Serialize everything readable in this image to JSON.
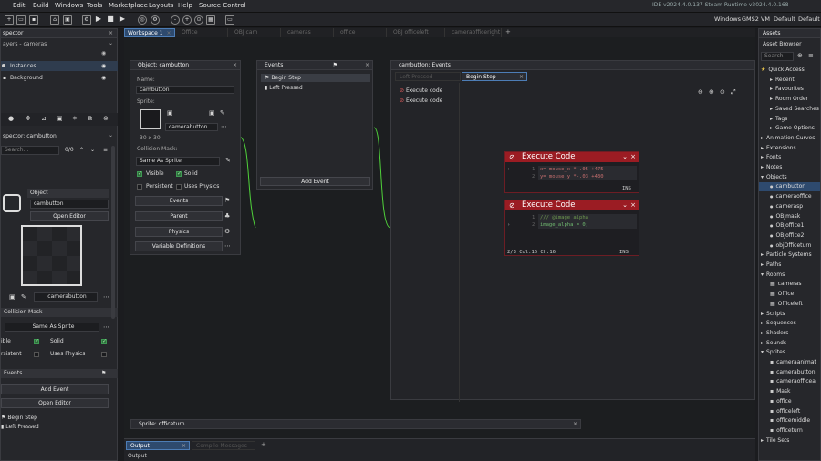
{
  "menu": {
    "items": [
      "Edit",
      "Build",
      "Windows",
      "Tools",
      "Marketplace",
      "Layouts",
      "Help",
      "Source Control"
    ]
  },
  "ide_info": "IDE v2024.4.0.137 Steam Runtime v2024.4.0.168",
  "target": {
    "platform": "Windows",
    "vm": "GMS2 VM",
    "config1": "Default",
    "config2": "Default"
  },
  "workspace_tab": "Workspace 1",
  "inactive_tabs": [
    "Office",
    "OBJ cam",
    "cameras",
    "office",
    "OBJ officeleft",
    "cameraofficeright"
  ],
  "left_inspector": {
    "title": "spector",
    "layers_label": "ayers - cameras",
    "layers": [
      "Instances",
      "Background"
    ],
    "sub_title": "spector: cambutton",
    "search_placeholder": "Search...",
    "count": "0/0",
    "object_section": "Object",
    "object_name": "cambutton",
    "open_editor": "Open Editor",
    "sprite_name": "camerabutton",
    "collision_section": "Collision Mask",
    "collision_value": "Same As Sprite",
    "visible": "ible",
    "solid": "Solid",
    "persistent": "rsistent",
    "uses_physics": "Uses Physics",
    "events_section": "Events",
    "add_event": "Add Event",
    "open_editor2": "Open Editor",
    "events": [
      "Begin Step",
      "Left Pressed"
    ]
  },
  "object_panel": {
    "title": "Object: cambutton",
    "name_label": "Name:",
    "name_value": "cambutton",
    "sprite_label": "Sprite:",
    "sprite_name": "camerabutton",
    "sprite_size": "30 x 30",
    "collision_label": "Collision Mask:",
    "collision_value": "Same As Sprite",
    "visible": "Visible",
    "solid": "Solid",
    "persistent": "Persistent",
    "uses_physics": "Uses Physics",
    "buttons": [
      "Events",
      "Parent",
      "Physics",
      "Variable Definitions"
    ]
  },
  "events_panel": {
    "title": "Events",
    "events": [
      "Begin Step",
      "Left Pressed"
    ],
    "add_event": "Add Event"
  },
  "code_window": {
    "title": "cambutton: Events",
    "tabs": [
      "Left Pressed",
      "Begin Step"
    ],
    "execute_list": [
      "Execute code",
      "Execute code"
    ],
    "blocks": [
      {
        "title": "Execute Code",
        "lines": [
          "x= mouse_x *-.05 +475",
          "y= mouse_y *-.03 +430"
        ],
        "status": "INS"
      },
      {
        "title": "Execute Code",
        "lines": [
          "/// @image alpha",
          "image_alpha = 0;"
        ],
        "status_left": "2/3 Col:16 Ch:16",
        "status": "INS"
      }
    ]
  },
  "sprite_panel_title": "Sprite: officeturn",
  "output": {
    "tab": "Output",
    "tab2": "Compile Messages",
    "label": "Output"
  },
  "assets": {
    "title": "Assets",
    "browser": "Asset Browser",
    "search_placeholder": "Search",
    "items": [
      {
        "label": "Quick Access",
        "indent": 0,
        "type": "star"
      },
      {
        "label": "Recent",
        "indent": 1,
        "type": "icon"
      },
      {
        "label": "Favourites",
        "indent": 1,
        "type": "icon"
      },
      {
        "label": "Room Order",
        "indent": 1,
        "type": "icon"
      },
      {
        "label": "Saved Searches",
        "indent": 1,
        "type": "icon"
      },
      {
        "label": "Tags",
        "indent": 1,
        "type": "icon"
      },
      {
        "label": "Game Options",
        "indent": 1,
        "type": "icon"
      },
      {
        "label": "Animation Curves",
        "indent": 0,
        "type": "folder"
      },
      {
        "label": "Extensions",
        "indent": 0,
        "type": "folder"
      },
      {
        "label": "Fonts",
        "indent": 0,
        "type": "folder"
      },
      {
        "label": "Notes",
        "indent": 0,
        "type": "folder"
      },
      {
        "label": "Objects",
        "indent": 0,
        "type": "folder-open"
      },
      {
        "label": "cambutton",
        "indent": 1,
        "type": "dot",
        "selected": true
      },
      {
        "label": "cameraoffice",
        "indent": 1,
        "type": "dot"
      },
      {
        "label": "camerasp",
        "indent": 1,
        "type": "dot"
      },
      {
        "label": "OBJmask",
        "indent": 1,
        "type": "dot"
      },
      {
        "label": "OBJoffice1",
        "indent": 1,
        "type": "dot"
      },
      {
        "label": "OBJoffice2",
        "indent": 1,
        "type": "dot"
      },
      {
        "label": "objOfficeturn",
        "indent": 1,
        "type": "dot"
      },
      {
        "label": "Particle Systems",
        "indent": 0,
        "type": "folder"
      },
      {
        "label": "Paths",
        "indent": 0,
        "type": "folder"
      },
      {
        "label": "Rooms",
        "indent": 0,
        "type": "folder-open"
      },
      {
        "label": "cameras",
        "indent": 1,
        "type": "grid"
      },
      {
        "label": "Office",
        "indent": 1,
        "type": "grid"
      },
      {
        "label": "Officeleft",
        "indent": 1,
        "type": "grid"
      },
      {
        "label": "Scripts",
        "indent": 0,
        "type": "folder"
      },
      {
        "label": "Sequences",
        "indent": 0,
        "type": "folder"
      },
      {
        "label": "Shaders",
        "indent": 0,
        "type": "folder"
      },
      {
        "label": "Sounds",
        "indent": 0,
        "type": "folder"
      },
      {
        "label": "Sprites",
        "indent": 0,
        "type": "folder-open"
      },
      {
        "label": "cameraanimat",
        "indent": 1,
        "type": "thumb"
      },
      {
        "label": "camerabutton",
        "indent": 1,
        "type": "thumb"
      },
      {
        "label": "cameraofficea",
        "indent": 1,
        "type": "thumb"
      },
      {
        "label": "Mask",
        "indent": 1,
        "type": "thumb"
      },
      {
        "label": "office",
        "indent": 1,
        "type": "thumb"
      },
      {
        "label": "officeleft",
        "indent": 1,
        "type": "thumb"
      },
      {
        "label": "officemiddle",
        "indent": 1,
        "type": "thumb"
      },
      {
        "label": "officeturn",
        "indent": 1,
        "type": "thumb"
      },
      {
        "label": "Tile Sets",
        "indent": 0,
        "type": "folder"
      }
    ]
  },
  "colors": {
    "accent": "#4d7db6",
    "exec_red": "#9b1c23",
    "link_green": "#4fd13a",
    "bg": "#1b1c1f"
  }
}
